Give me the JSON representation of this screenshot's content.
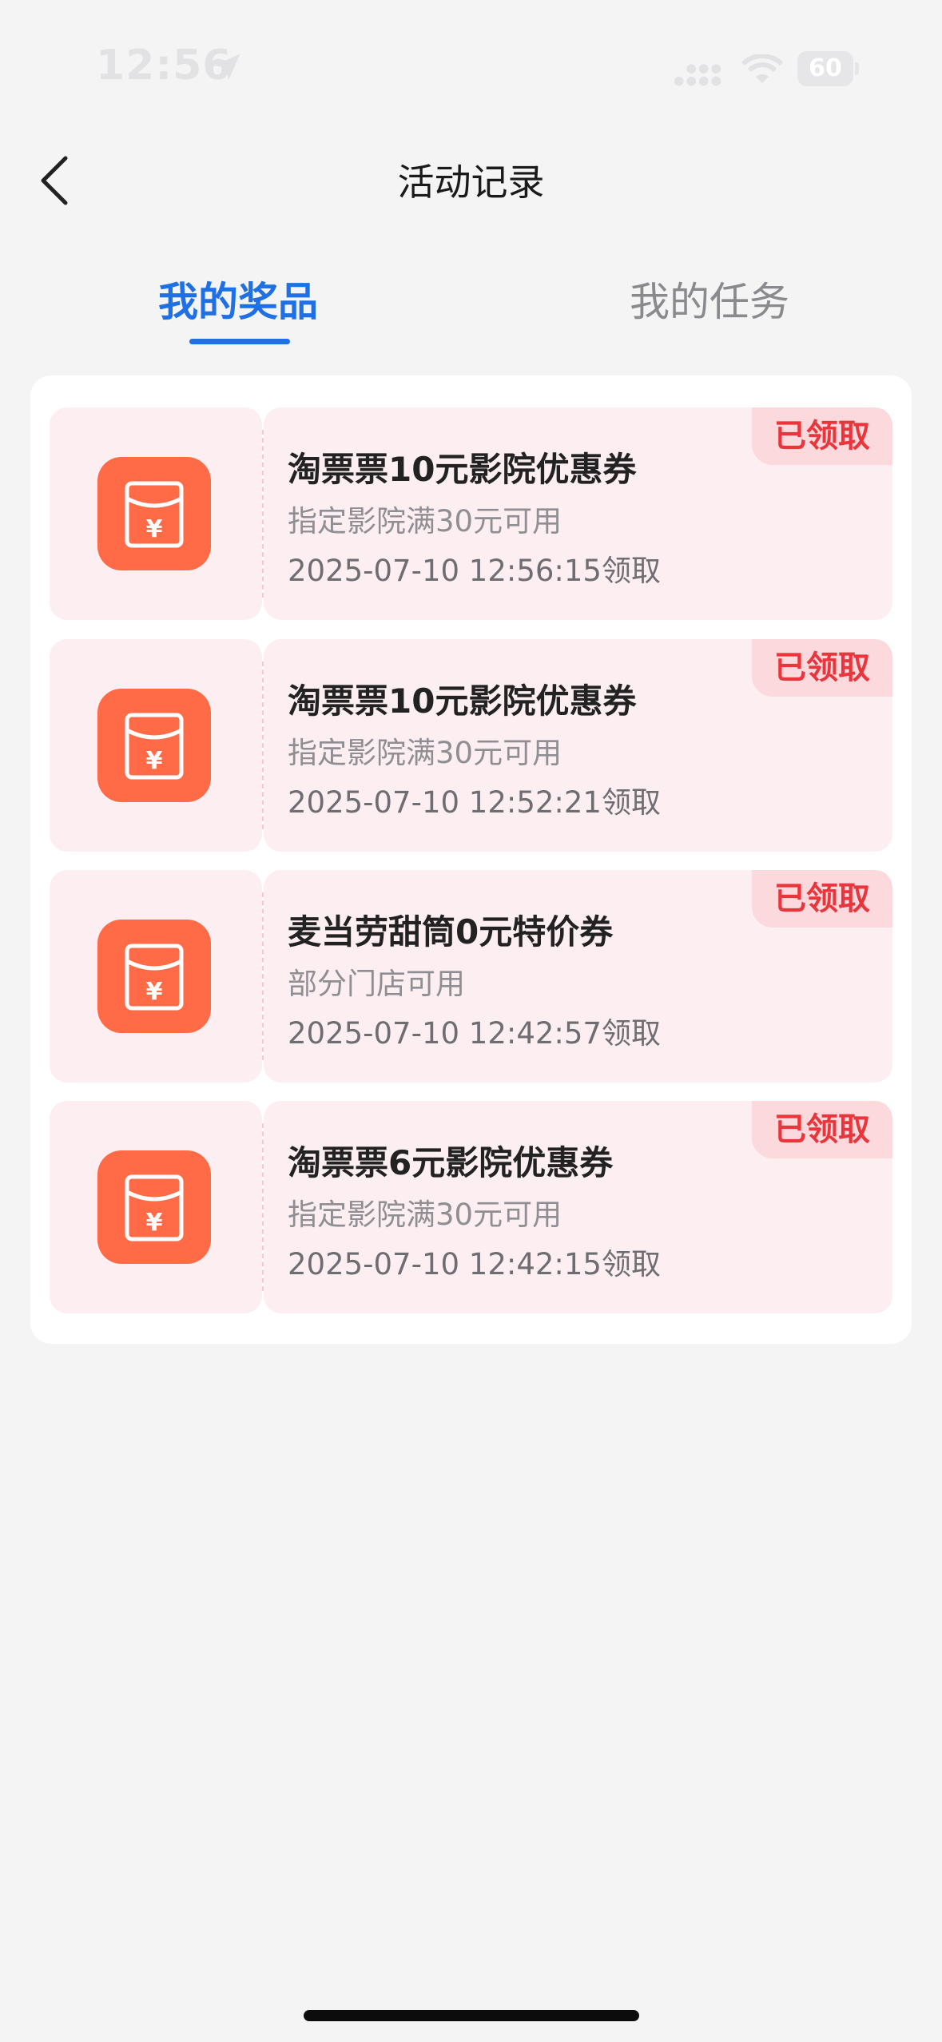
{
  "status_bar": {
    "time": "12:56",
    "battery": "60",
    "icons": [
      "location-arrow-icon",
      "signal-icon",
      "wifi-icon",
      "battery-icon"
    ]
  },
  "nav": {
    "title": "活动记录",
    "back_icon": "chevron-left-icon"
  },
  "tabs": [
    {
      "label": "我的奖品",
      "active": true
    },
    {
      "label": "我的任务",
      "active": false
    }
  ],
  "coupons": [
    {
      "title": "淘票票10元影院优惠券",
      "condition": "指定影院满30元可用",
      "time": "2025-07-10 12:56:15领取",
      "status": "已领取",
      "icon": "red-envelope-yuan-icon"
    },
    {
      "title": "淘票票10元影院优惠券",
      "condition": "指定影院满30元可用",
      "time": "2025-07-10 12:52:21领取",
      "status": "已领取",
      "icon": "red-envelope-yuan-icon"
    },
    {
      "title": "麦当劳甜筒0元特价券",
      "condition": "部分门店可用",
      "time": "2025-07-10 12:42:57领取",
      "status": "已领取",
      "icon": "red-envelope-yuan-icon"
    },
    {
      "title": "淘票票6元影院优惠券",
      "condition": "指定影院满30元可用",
      "time": "2025-07-10 12:42:15领取",
      "status": "已领取",
      "icon": "red-envelope-yuan-icon"
    }
  ],
  "colors": {
    "accent": "#1f6fe5",
    "envelope": "#ff6a47",
    "claimed_text": "#e8363c",
    "card_bg": "#fdeff1"
  }
}
